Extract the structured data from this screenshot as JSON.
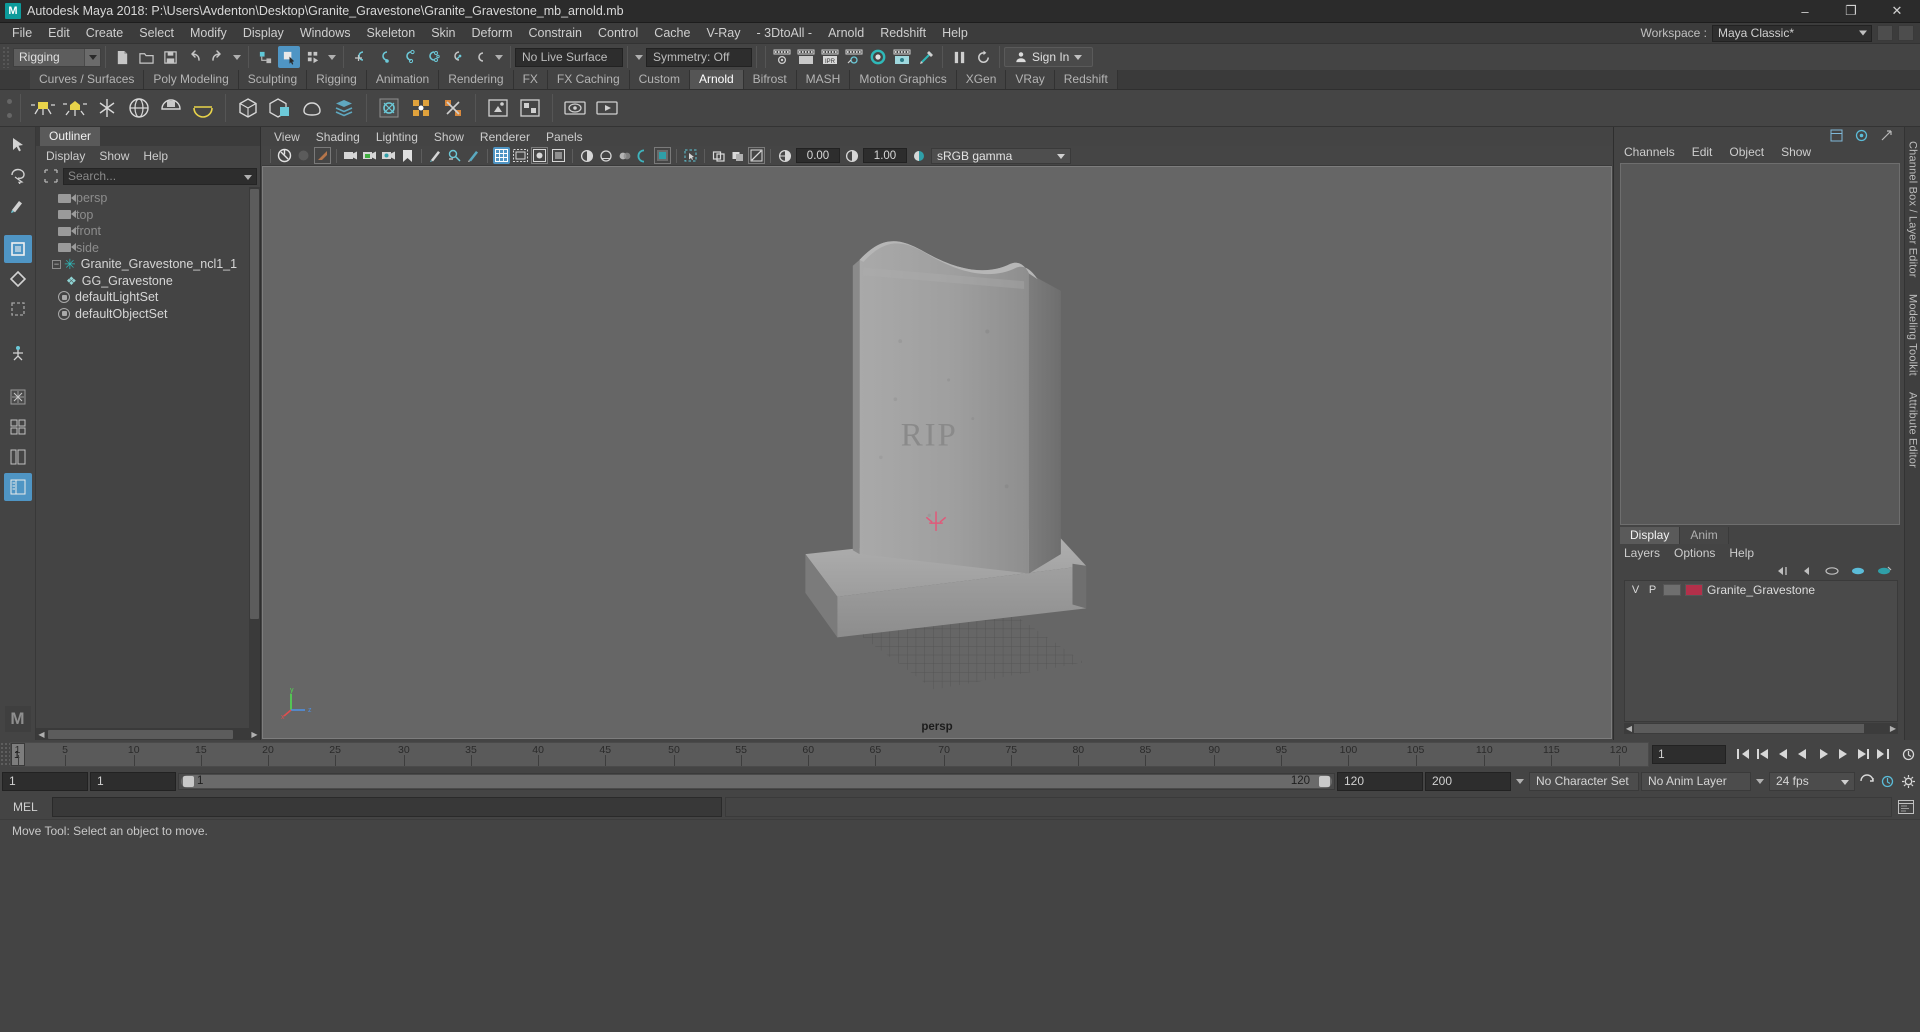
{
  "window": {
    "title": "Autodesk Maya 2018: P:\\Users\\Avdenton\\Desktop\\Granite_Gravestone\\Granite_Gravestone_mb_arnold.mb",
    "app_icon": "M",
    "minimize": "–",
    "maximize": "❐",
    "close": "✕"
  },
  "menubar": {
    "items": [
      "File",
      "Edit",
      "Create",
      "Select",
      "Modify",
      "Display",
      "Windows",
      "Skeleton",
      "Skin",
      "Deform",
      "Constrain",
      "Control",
      "Cache",
      "V-Ray",
      "- 3DtoAll -",
      "Arnold",
      "Redshift",
      "Help"
    ],
    "workspace_label": "Workspace :",
    "workspace_value": "Maya Classic*"
  },
  "statusline": {
    "menuset": "Rigging",
    "live_surface": "No Live Surface",
    "symmetry": "Symmetry: Off",
    "signin": "Sign In",
    "signin_icon": "person-icon"
  },
  "shelf": {
    "tabs": [
      "Curves / Surfaces",
      "Poly Modeling",
      "Sculpting",
      "Rigging",
      "Animation",
      "Rendering",
      "FX",
      "FX Caching",
      "Custom",
      "Arnold",
      "Bifrost",
      "MASH",
      "Motion Graphics",
      "XGen",
      "VRay",
      "Redshift"
    ],
    "active_tab": "Arnold"
  },
  "outliner": {
    "tab_label": "Outliner",
    "menus": [
      "Display",
      "Show",
      "Help"
    ],
    "search_placeholder": "Search...",
    "items": [
      {
        "label": "persp",
        "icon": "camera-icon",
        "indent": 1,
        "dim": true
      },
      {
        "label": "top",
        "icon": "camera-icon",
        "indent": 1,
        "dim": true
      },
      {
        "label": "front",
        "icon": "camera-icon",
        "indent": 1,
        "dim": true
      },
      {
        "label": "side",
        "icon": "camera-icon",
        "indent": 1,
        "dim": true
      },
      {
        "label": "Granite_Gravestone_ncl1_1",
        "icon": "star-icon",
        "indent": 0,
        "dim": false,
        "expander": "−"
      },
      {
        "label": "GG_Gravestone",
        "icon": "mesh-icon",
        "indent": 2,
        "dim": false
      },
      {
        "label": "defaultLightSet",
        "icon": "set-icon",
        "indent": 1,
        "dim": false
      },
      {
        "label": "defaultObjectSet",
        "icon": "set-icon",
        "indent": 1,
        "dim": false
      }
    ]
  },
  "viewport": {
    "menus": [
      "View",
      "Shading",
      "Lighting",
      "Show",
      "Renderer",
      "Panels"
    ],
    "exposure_value": "0.00",
    "gamma_value": "1.00",
    "colorspace": "sRGB gamma",
    "camera_label": "persp",
    "object_text": "RIP",
    "axis_x": "x",
    "axis_y": "y",
    "axis_z": "z"
  },
  "rightpanel": {
    "menus": [
      "Channels",
      "Edit",
      "Object",
      "Show"
    ],
    "layer_tabs": [
      "Display",
      "Anim"
    ],
    "layer_active_tab": "Display",
    "layer_menus": [
      "Layers",
      "Options",
      "Help"
    ],
    "layer_rows": [
      {
        "v": "V",
        "p": "P",
        "name": "Granite_Gravestone",
        "color": "#b3304a"
      }
    ],
    "vertical_tabs": [
      "Channel Box / Layer Editor",
      "Modeling Toolkit",
      "Attribute Editor"
    ]
  },
  "timeslider": {
    "current_frame": "1",
    "ticks": [
      {
        "label": "1",
        "pos": 0.4
      },
      {
        "label": "5",
        "pos": 3.3
      },
      {
        "label": "10",
        "pos": 7.5
      },
      {
        "label": "15",
        "pos": 11.6
      },
      {
        "label": "20",
        "pos": 15.7
      },
      {
        "label": "25",
        "pos": 19.8
      },
      {
        "label": "30",
        "pos": 24.0
      },
      {
        "label": "35",
        "pos": 28.1
      },
      {
        "label": "40",
        "pos": 32.2
      },
      {
        "label": "45",
        "pos": 36.3
      },
      {
        "label": "50",
        "pos": 40.5
      },
      {
        "label": "55",
        "pos": 44.6
      },
      {
        "label": "60",
        "pos": 48.7
      },
      {
        "label": "65",
        "pos": 52.8
      },
      {
        "label": "70",
        "pos": 57.0
      },
      {
        "label": "75",
        "pos": 61.1
      },
      {
        "label": "80",
        "pos": 65.2
      },
      {
        "label": "85",
        "pos": 69.3
      },
      {
        "label": "90",
        "pos": 73.5
      },
      {
        "label": "95",
        "pos": 77.6
      },
      {
        "label": "100",
        "pos": 81.7
      },
      {
        "label": "105",
        "pos": 85.8
      },
      {
        "label": "110",
        "pos": 90.0
      },
      {
        "label": "115",
        "pos": 94.1
      },
      {
        "label": "120",
        "pos": 98.2
      }
    ],
    "frame_field": "1",
    "controls": [
      "go-to-start-icon",
      "step-back-key-icon",
      "step-back-frame-icon",
      "play-backwards-icon",
      "play-forwards-icon",
      "step-forward-frame-icon",
      "step-forward-key-icon",
      "go-to-end-icon"
    ]
  },
  "rangeslider": {
    "anim_start": "1",
    "range_start": "1",
    "slider_start_label": "1",
    "slider_end_label": "120",
    "range_end": "120",
    "anim_end": "200",
    "character_set": "No Character Set",
    "anim_layer": "No Anim Layer",
    "fps": "24 fps"
  },
  "commandline": {
    "language": "MEL",
    "input_value": "",
    "output_value": ""
  },
  "helpline": {
    "text": "Move Tool: Select an object to move."
  },
  "colors": {
    "accent_blue": "#4f95c4",
    "teal": "#2fb9b9",
    "layer_red": "#b3304a",
    "panel_bg": "#444444",
    "viewport_bg": "#666666",
    "titlebar_bg": "#2b2b2b"
  }
}
